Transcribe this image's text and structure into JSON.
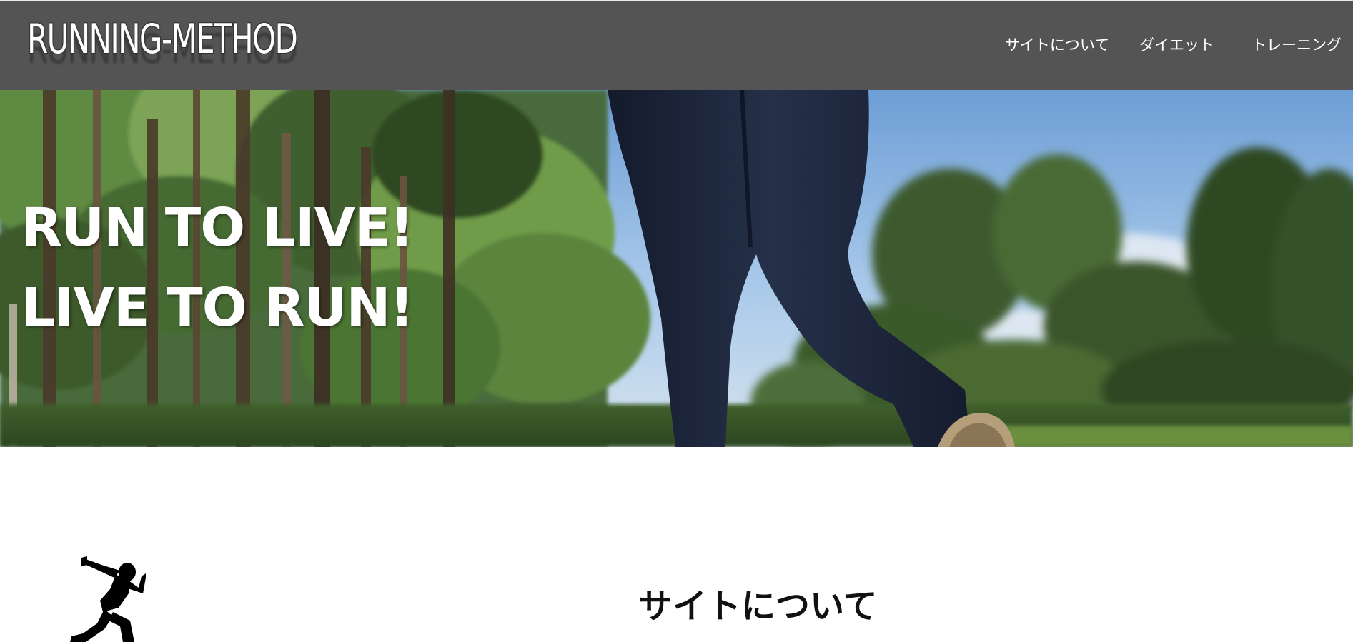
{
  "header": {
    "logo_text": "RUNNING-METHOD",
    "nav": [
      {
        "label": "サイトについて"
      },
      {
        "label": "ダイエット"
      },
      {
        "label": "トレーニング"
      }
    ],
    "background": "#545454"
  },
  "hero": {
    "line1": "RUN TO LIVE!",
    "line2": "LIVE TO RUN!",
    "image": "running-legs-in-park-photo"
  },
  "about": {
    "icon": "runner-silhouette-icon",
    "title": "サイトについて"
  }
}
